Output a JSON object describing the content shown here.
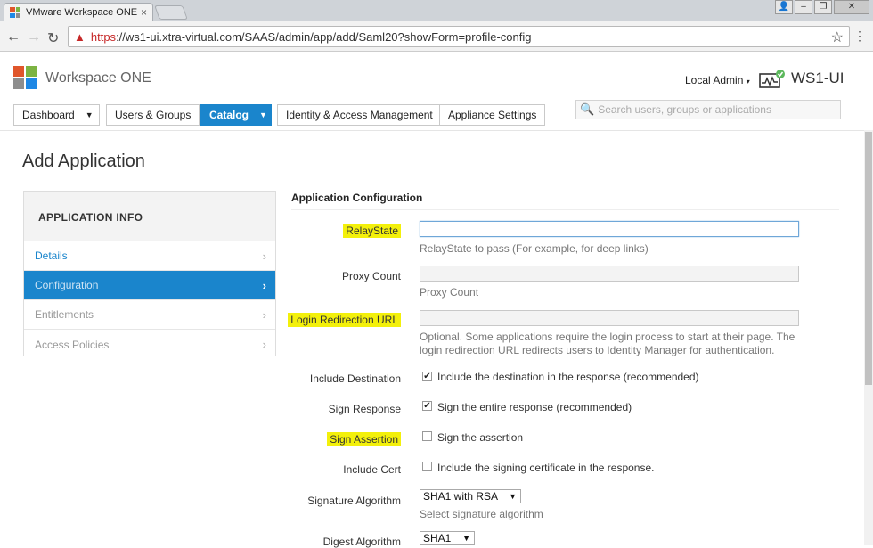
{
  "browser": {
    "tab_title": "VMware Workspace ONE",
    "tab_close": "×",
    "url_scheme": "https",
    "url_rest": "://ws1-ui.xtra-virtual.com/SAAS/admin/app/add/Saml20?showForm=profile-config"
  },
  "header": {
    "brand": "Workspace ONE",
    "admin_label": "Local Admin",
    "tenant": "WS1-UI",
    "search_placeholder": "Search users, groups or applications"
  },
  "nav": {
    "dashboard": "Dashboard",
    "users_groups": "Users & Groups",
    "catalog": "Catalog",
    "identity": "Identity & Access Management",
    "appliance": "Appliance Settings"
  },
  "page": {
    "title": "Add Application"
  },
  "sidebar": {
    "heading": "APPLICATION INFO",
    "items": [
      {
        "label": "Details"
      },
      {
        "label": "Configuration"
      },
      {
        "label": "Entitlements"
      },
      {
        "label": "Access Policies"
      }
    ]
  },
  "form": {
    "section_title": "Application Configuration",
    "relay_state": {
      "label": "RelayState",
      "value": "",
      "help": "RelayState to pass (For example, for deep links)"
    },
    "proxy_count": {
      "label": "Proxy Count",
      "value": "",
      "help": "Proxy Count"
    },
    "login_redirect": {
      "label": "Login Redirection URL",
      "value": "",
      "help": "Optional. Some applications require the login process to start at their page. The login redirection URL redirects users to Identity Manager for authentication."
    },
    "include_destination": {
      "label": "Include Destination",
      "checked": true,
      "text": "Include the destination in the response (recommended)"
    },
    "sign_response": {
      "label": "Sign Response",
      "checked": true,
      "text": "Sign the entire response (recommended)"
    },
    "sign_assertion": {
      "label": "Sign Assertion",
      "checked": false,
      "text": "Sign the assertion"
    },
    "include_cert": {
      "label": "Include Cert",
      "checked": false,
      "text": "Include the signing certificate in the response."
    },
    "signature_algorithm": {
      "label": "Signature Algorithm",
      "value": "SHA1 with RSA",
      "help": "Select signature algorithm"
    },
    "digest_algorithm": {
      "label": "Digest Algorithm",
      "value": "SHA1"
    }
  },
  "colors": {
    "accent": "#1a85cc",
    "highlight": "#f3f00b"
  }
}
